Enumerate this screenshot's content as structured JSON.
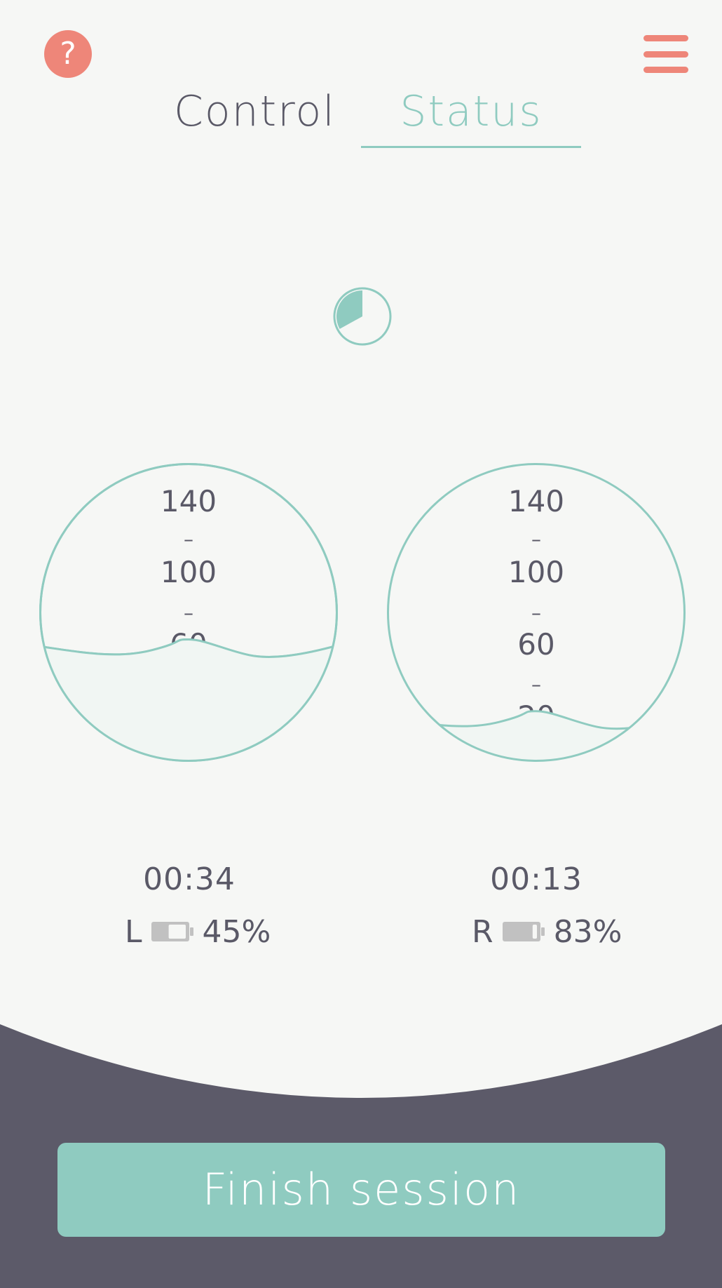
{
  "header": {
    "help_icon": "question-mark-icon",
    "help_glyph": "?",
    "menu_icon": "hamburger-menu-icon"
  },
  "tabs": [
    {
      "label": "Control",
      "active": false
    },
    {
      "label": "Status",
      "active": true
    }
  ],
  "timer": {
    "icon": "timer-pie-icon",
    "progress_fraction": 0.33
  },
  "gauges": {
    "left": {
      "labels": [
        "140",
        "100",
        "60"
      ],
      "fill_level_fraction": 0.38
    },
    "right": {
      "labels": [
        "140",
        "100",
        "60",
        "20"
      ],
      "fill_level_fraction": 0.14
    }
  },
  "readouts": {
    "left": {
      "time": "00:34",
      "side": "L",
      "battery_percent": "45%",
      "battery_fraction": 0.45
    },
    "right": {
      "time": "00:13",
      "side": "R",
      "battery_percent": "83%",
      "battery_fraction": 0.83
    }
  },
  "footer": {
    "finish_label": "Finish session"
  },
  "colors": {
    "background": "#f6f7f5",
    "accent": "#8fcbc0",
    "coral": "#ee8679",
    "text": "#5a5967",
    "panel": "#5c5a69",
    "battery": "#c1c1c1"
  }
}
